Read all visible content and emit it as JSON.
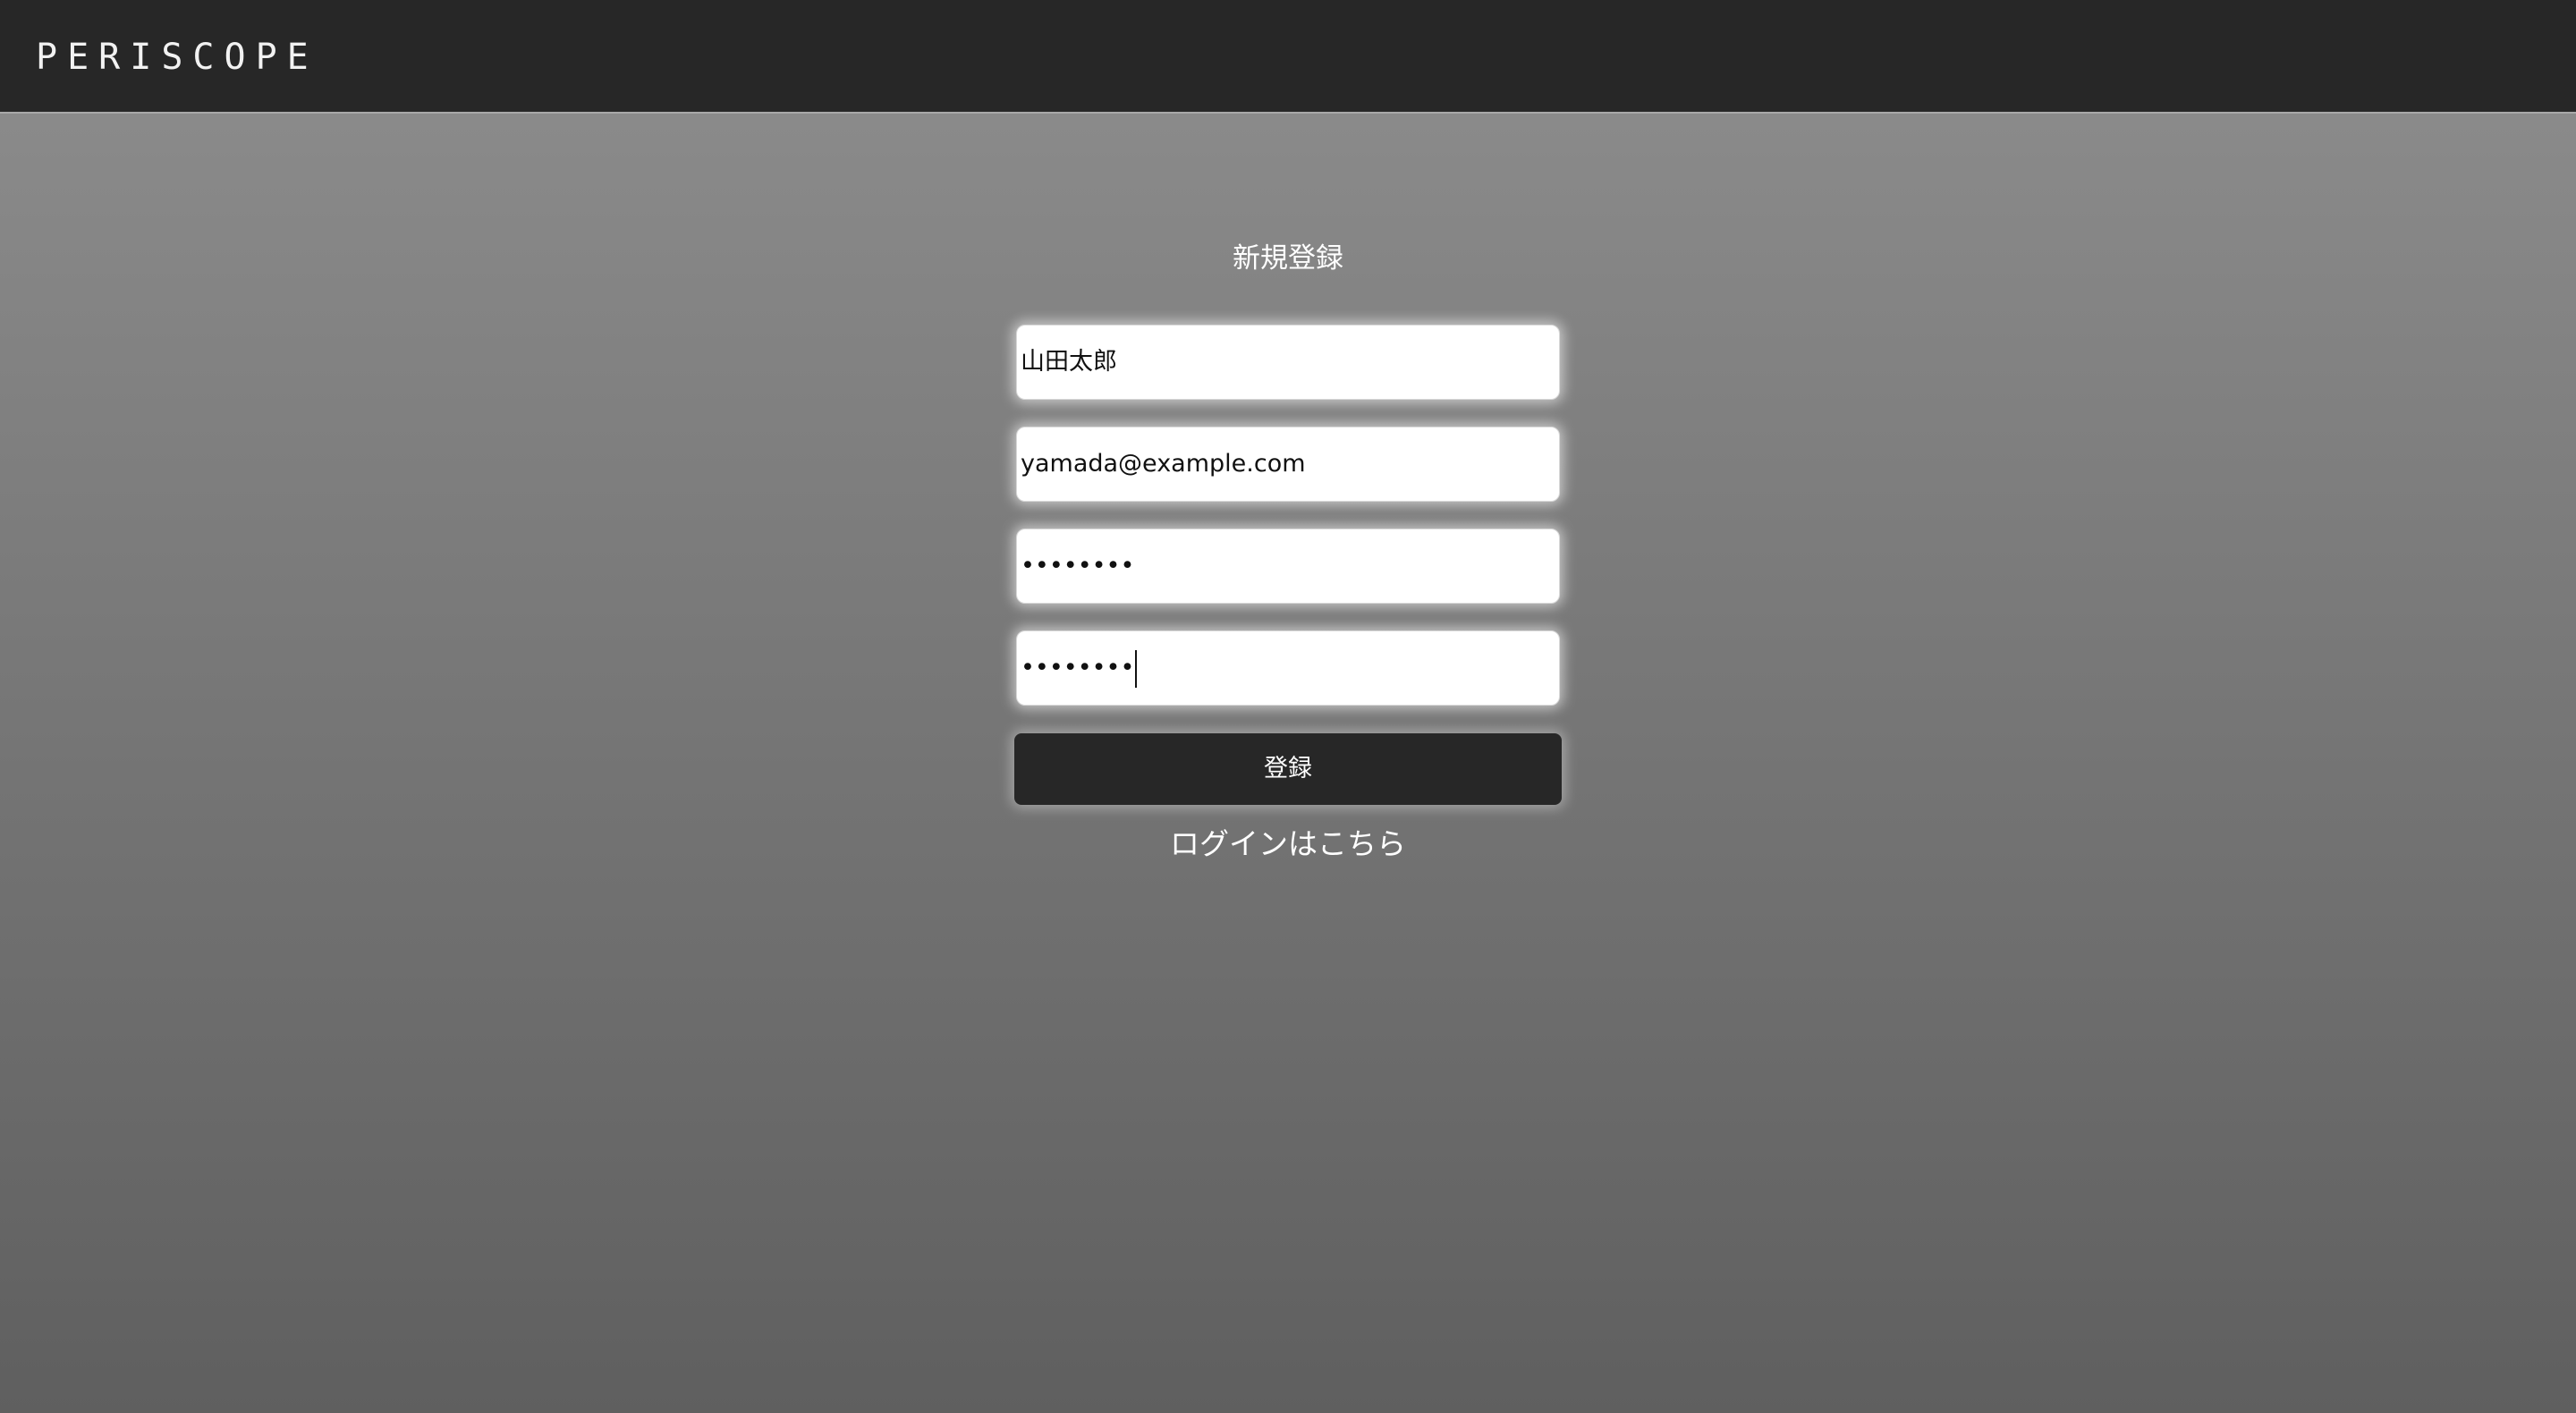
{
  "header": {
    "brand": "PERISCOPE"
  },
  "form": {
    "title": "新規登録",
    "name_value": "山田太郎",
    "email_value": "yamada@example.com",
    "password_value": "••••••••",
    "password_confirm_value": "••••••••",
    "submit_label": "登録",
    "login_link_label": "ログインはこちら"
  },
  "colors": {
    "header_bg": "#272727",
    "button_bg": "#272727",
    "background_top": "#8a8a8a",
    "background_bottom": "#5f5f5f"
  }
}
